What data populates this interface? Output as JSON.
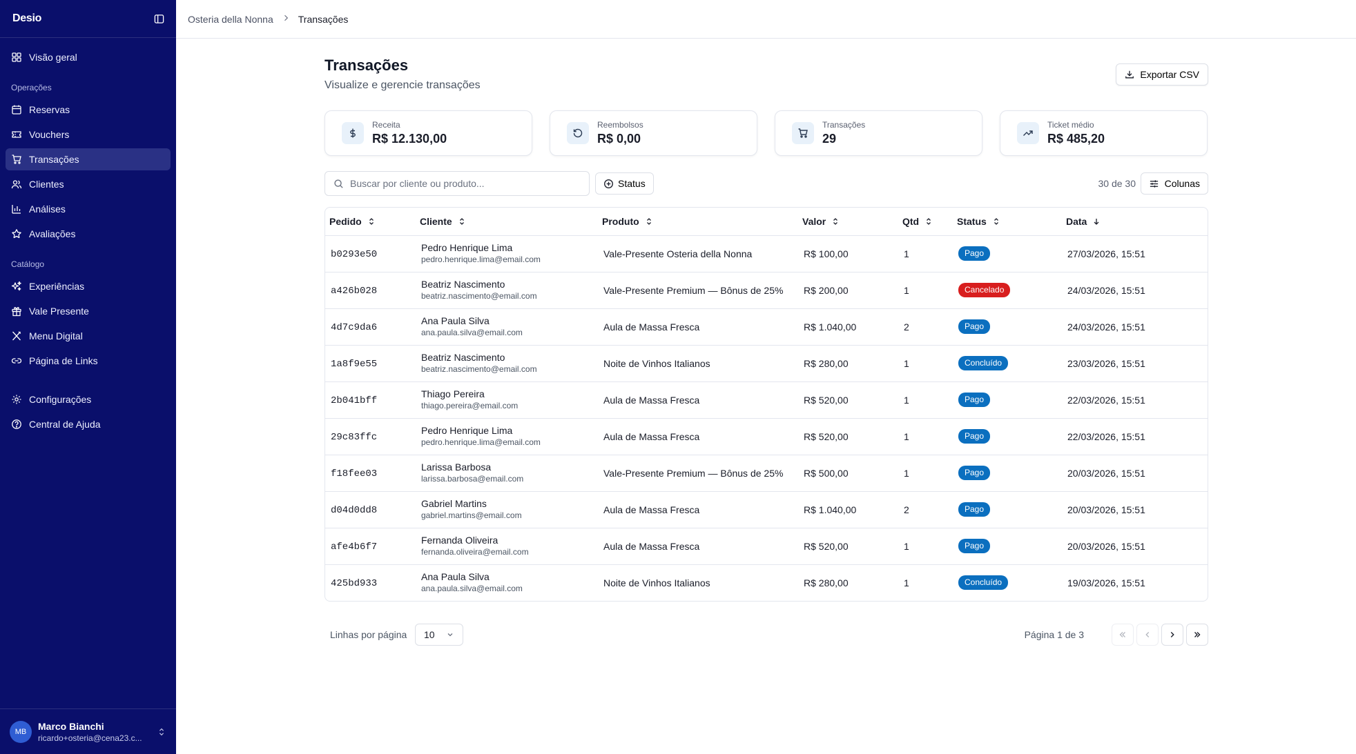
{
  "app": {
    "logo": "Desio"
  },
  "sidebar": {
    "items_top": [
      {
        "label": "Visão geral",
        "icon": "dashboard-icon"
      }
    ],
    "section_operations": "Operações",
    "operations": [
      {
        "label": "Reservas",
        "icon": "calendar-icon"
      },
      {
        "label": "Vouchers",
        "icon": "ticket-icon"
      },
      {
        "label": "Transações",
        "icon": "cart-icon",
        "active": true
      },
      {
        "label": "Clientes",
        "icon": "users-icon"
      },
      {
        "label": "Análises",
        "icon": "bar-chart-icon"
      },
      {
        "label": "Avaliações",
        "icon": "star-icon"
      }
    ],
    "section_catalog": "Catálogo",
    "catalog": [
      {
        "label": "Experiências",
        "icon": "sparkles-icon"
      },
      {
        "label": "Vale Presente",
        "icon": "gift-icon"
      },
      {
        "label": "Menu Digital",
        "icon": "utensils-icon"
      },
      {
        "label": "Página de Links",
        "icon": "link-icon"
      }
    ],
    "bottom": [
      {
        "label": "Configurações",
        "icon": "gear-icon"
      },
      {
        "label": "Central de Ajuda",
        "icon": "help-circle-icon"
      }
    ],
    "user": {
      "initials": "MB",
      "name": "Marco Bianchi",
      "email": "ricardo+osteria@cena23.c..."
    }
  },
  "breadcrumb": {
    "parent": "Osteria della Nonna",
    "current": "Transações"
  },
  "page": {
    "title": "Transações",
    "subtitle": "Visualize e gerencie transações",
    "export_label": "Exportar CSV"
  },
  "stats": [
    {
      "label": "Receita",
      "value": "R$ 12.130,00",
      "icon": "dollar-icon"
    },
    {
      "label": "Reembolsos",
      "value": "R$ 0,00",
      "icon": "refund-icon"
    },
    {
      "label": "Transações",
      "value": "29",
      "icon": "cart-icon"
    },
    {
      "label": "Ticket médio",
      "value": "R$ 485,20",
      "icon": "trending-up-icon"
    }
  ],
  "toolbar": {
    "search_placeholder": "Buscar por cliente ou produto...",
    "search_value": "",
    "status_label": "Status",
    "count": "30 de 30",
    "columns_label": "Colunas"
  },
  "table": {
    "headers": [
      "Pedido",
      "Cliente",
      "Produto",
      "Valor",
      "Qtd",
      "Status",
      "Data"
    ],
    "rows": [
      {
        "id": "b0293e50",
        "name": "Pedro Henrique Lima",
        "email": "pedro.henrique.lima@email.com",
        "product": "Vale-Presente Osteria della Nonna",
        "value": "R$ 100,00",
        "qty": "1",
        "status": "Pago",
        "date": "27/03/2026, 15:51"
      },
      {
        "id": "a426b028",
        "name": "Beatriz Nascimento",
        "email": "beatriz.nascimento@email.com",
        "product": "Vale-Presente Premium — Bônus de 25%",
        "value": "R$ 200,00",
        "qty": "1",
        "status": "Cancelado",
        "date": "24/03/2026, 15:51"
      },
      {
        "id": "4d7c9da6",
        "name": "Ana Paula Silva",
        "email": "ana.paula.silva@email.com",
        "product": "Aula de Massa Fresca",
        "value": "R$ 1.040,00",
        "qty": "2",
        "status": "Pago",
        "date": "24/03/2026, 15:51"
      },
      {
        "id": "1a8f9e55",
        "name": "Beatriz Nascimento",
        "email": "beatriz.nascimento@email.com",
        "product": "Noite de Vinhos Italianos",
        "value": "R$ 280,00",
        "qty": "1",
        "status": "Concluído",
        "date": "23/03/2026, 15:51"
      },
      {
        "id": "2b041bff",
        "name": "Thiago Pereira",
        "email": "thiago.pereira@email.com",
        "product": "Aula de Massa Fresca",
        "value": "R$ 520,00",
        "qty": "1",
        "status": "Pago",
        "date": "22/03/2026, 15:51"
      },
      {
        "id": "29c83ffc",
        "name": "Pedro Henrique Lima",
        "email": "pedro.henrique.lima@email.com",
        "product": "Aula de Massa Fresca",
        "value": "R$ 520,00",
        "qty": "1",
        "status": "Pago",
        "date": "22/03/2026, 15:51"
      },
      {
        "id": "f18fee03",
        "name": "Larissa Barbosa",
        "email": "larissa.barbosa@email.com",
        "product": "Vale-Presente Premium — Bônus de 25%",
        "value": "R$ 500,00",
        "qty": "1",
        "status": "Pago",
        "date": "20/03/2026, 15:51"
      },
      {
        "id": "d04d0dd8",
        "name": "Gabriel Martins",
        "email": "gabriel.martins@email.com",
        "product": "Aula de Massa Fresca",
        "value": "R$ 1.040,00",
        "qty": "2",
        "status": "Pago",
        "date": "20/03/2026, 15:51"
      },
      {
        "id": "afe4b6f7",
        "name": "Fernanda Oliveira",
        "email": "fernanda.oliveira@email.com",
        "product": "Aula de Massa Fresca",
        "value": "R$ 520,00",
        "qty": "1",
        "status": "Pago",
        "date": "20/03/2026, 15:51"
      },
      {
        "id": "425bd933",
        "name": "Ana Paula Silva",
        "email": "ana.paula.silva@email.com",
        "product": "Noite de Vinhos Italianos",
        "value": "R$ 280,00",
        "qty": "1",
        "status": "Concluído",
        "date": "19/03/2026, 15:51"
      }
    ]
  },
  "status_colors": {
    "Pago": "#0b6fbf",
    "Cancelado": "#d81e1e",
    "Concluído": "#0b6fbf"
  },
  "pagination": {
    "rows_label": "Linhas por página",
    "rows_value": "10",
    "page_info": "Página 1 de 3"
  },
  "colors": {
    "sidebar_bg": "#0a0f6b",
    "sidebar_active": "#2a3185",
    "accent": "#0b6fbf"
  }
}
